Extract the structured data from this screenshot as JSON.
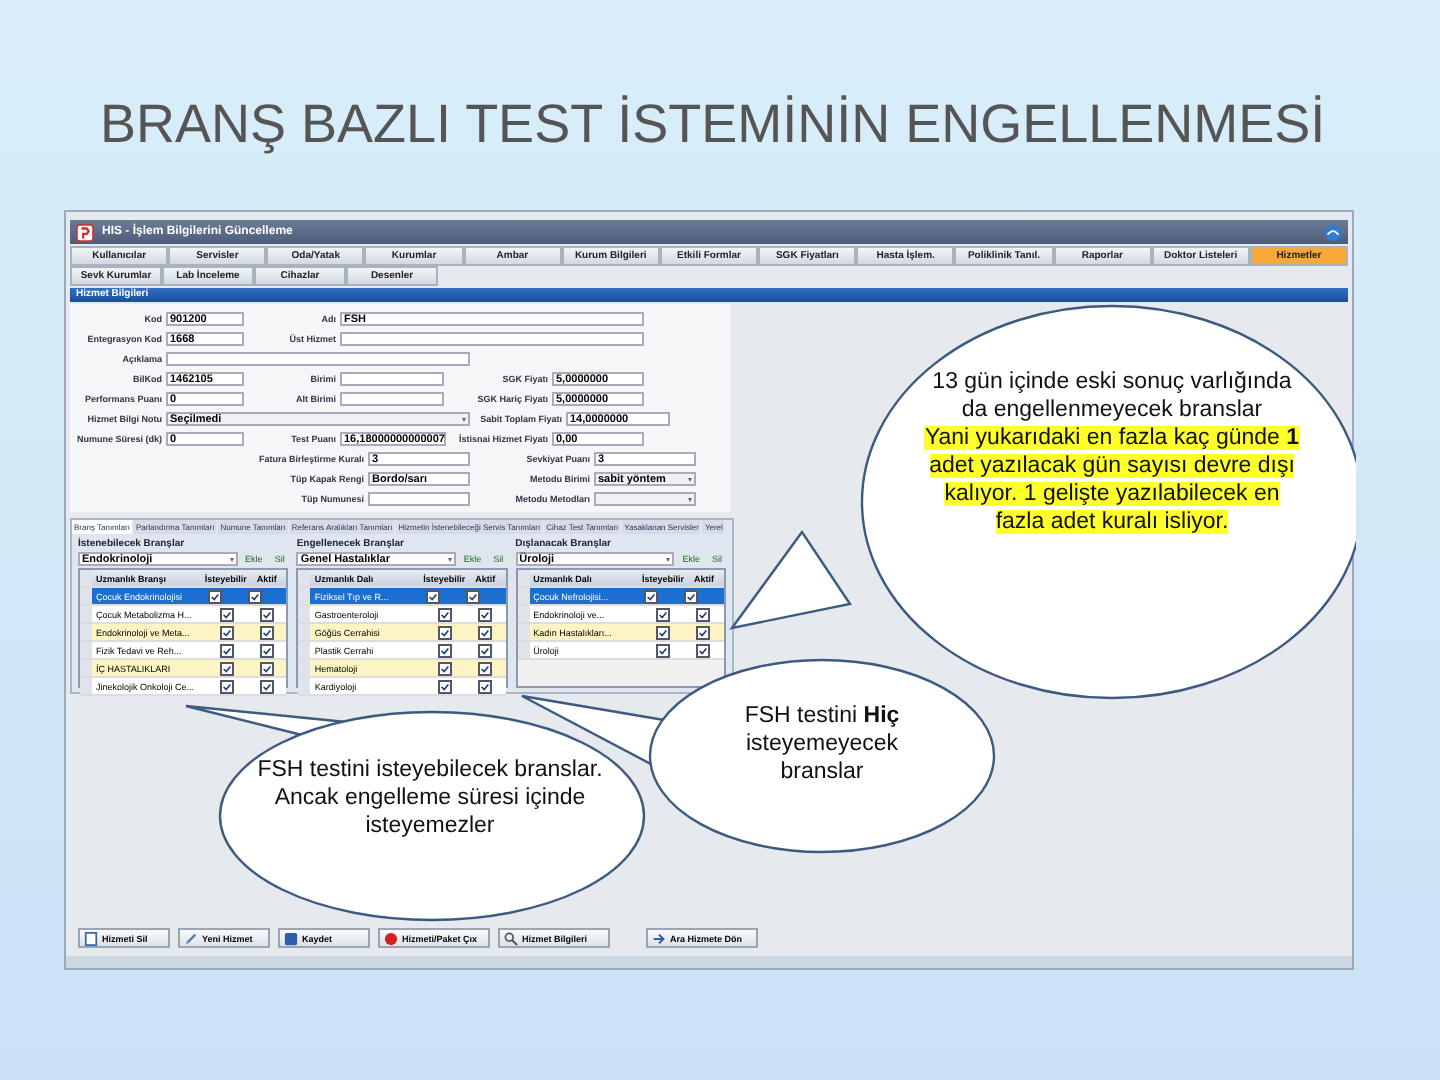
{
  "slide": {
    "title": "BRANŞ BAZLI TEST İSTEMİNİN ENGELLENMESİ"
  },
  "window": {
    "title": "HIS - İşlem Bilgilerini Güncelleme"
  },
  "menu_rows": [
    {
      "items": [
        {
          "label": "Kullanıcılar",
          "selected": false
        },
        {
          "label": "Servisler",
          "selected": false
        },
        {
          "label": "Oda/Yatak",
          "selected": false
        },
        {
          "label": "Kurumlar",
          "selected": false
        },
        {
          "label": "Ambar",
          "selected": false
        },
        {
          "label": "Kurum Bilgileri",
          "selected": false
        },
        {
          "label": "Etkili Formlar",
          "selected": false
        },
        {
          "label": "SGK Fiyatları",
          "selected": false
        },
        {
          "label": "Hasta İşlem.",
          "selected": false
        },
        {
          "label": "Poliklinik Tanıl.",
          "selected": false
        },
        {
          "label": "Raporlar",
          "selected": false
        },
        {
          "label": "Doktor Listeleri",
          "selected": false
        },
        {
          "label": "Hizmetler",
          "selected": true
        }
      ]
    },
    {
      "items": [
        {
          "label": "Sevk Kurumlar",
          "selected": false
        },
        {
          "label": "Lab İnceleme",
          "selected": false
        },
        {
          "label": "Cihazlar",
          "selected": false
        },
        {
          "label": "Desenler",
          "selected": false
        }
      ]
    }
  ],
  "section_header": "Hizmet Bilgileri",
  "form": {
    "main_rows": [
      {
        "fields": [
          {
            "label": "Kod",
            "value": "901200",
            "kind": "text"
          },
          {
            "label": "Adı",
            "value": "FSH",
            "kind": "wide"
          }
        ]
      },
      {
        "fields": [
          {
            "label": "Entegrasyon Kod",
            "value": "1668",
            "kind": "text"
          },
          {
            "label": "Üst Hizmet",
            "kind": "wide"
          }
        ]
      },
      {
        "fields": [
          {
            "label": "Açıklama",
            "kind": "wide"
          }
        ]
      },
      {
        "fields": [
          {
            "label": "BilKod",
            "value": "1462105",
            "kind": "text"
          },
          {
            "label": "Birimi",
            "kind": "text"
          },
          {
            "label": "SGK Fiyatı",
            "value": "5,0000000",
            "kind": "text"
          }
        ]
      },
      {
        "fields": [
          {
            "label": "Performans Puanı",
            "value": "0",
            "kind": "text"
          },
          {
            "label": "Alt Birimi",
            "kind": "text"
          },
          {
            "label": "SGK Hariç Fiyatı",
            "value": "5,0000000",
            "kind": "text"
          }
        ]
      },
      {
        "fields": [
          {
            "label": "Hizmet Bilgi Notu",
            "value": "Seçilmedi",
            "kind": "select"
          },
          {
            "label": "Sabit Toplam Fiyatı",
            "value": "14,0000000",
            "kind": "text"
          }
        ]
      },
      {
        "fields": [
          {
            "label": "Numune Süresi (dk)",
            "value": "0",
            "kind": "text"
          },
          {
            "label": "Test Puanı",
            "value": "16,18000000000007",
            "kind": "text"
          },
          {
            "label": "İstisnai Hizmet Fiyatı",
            "value": "0,00",
            "kind": "text"
          }
        ]
      }
    ],
    "lower_rows": [
      {
        "fields": [
          {
            "label": "Fatura Birleştirme Kuralı",
            "value": "3",
            "kind": "text"
          },
          {
            "label": "Sevkiyat Puanı",
            "value": "3",
            "kind": "text"
          }
        ]
      },
      {
        "fields": [
          {
            "label": "Tüp Kapak Rengi",
            "value": "Bordo/sarı",
            "kind": "text"
          },
          {
            "label": "Metodu Birimi",
            "value": "sabit yöntem",
            "kind": "select"
          }
        ]
      },
      {
        "fields": [
          {
            "label": "Tüp Numunesi",
            "kind": "text"
          },
          {
            "label": "Metodu Metodları",
            "kind": "select"
          }
        ]
      }
    ]
  },
  "detail_tabs": [
    {
      "label": "Branş Tanımları",
      "selected": true
    },
    {
      "label": "Parlandırma Tanımları",
      "selected": false
    },
    {
      "label": "Numune Tanımları",
      "selected": false
    },
    {
      "label": "Referans Aralıkları Tanımları",
      "selected": false
    },
    {
      "label": "Hizmetin İstenebileceği Servis Tanımları",
      "selected": false
    },
    {
      "label": "Cihaz Test Tanımları",
      "selected": false
    },
    {
      "label": "Yasaklanan Servisler",
      "selected": false
    },
    {
      "label": "Yerel",
      "selected": false
    }
  ],
  "panels": [
    {
      "title": "İstenebilecek Branşlar",
      "selector": "Endokrinoloji",
      "buttons": [
        "Ekle",
        "Sil"
      ],
      "columns": [
        "Uzmanlık Branşı",
        "İsteyebilir",
        "Aktif"
      ],
      "rows": [
        {
          "name": "Çocuk Endokrinolojisi",
          "request": true,
          "active": true,
          "selected": true
        },
        {
          "name": "Çocuk Metabolizma H...",
          "request": true,
          "active": true,
          "selected": false
        },
        {
          "name": "Endokrinoloji ve Meta...",
          "request": true,
          "active": true,
          "selected": false
        },
        {
          "name": "Fizik Tedavi ve Reh...",
          "request": true,
          "active": true,
          "selected": false
        },
        {
          "name": "İÇ HASTALIKLARI",
          "request": true,
          "active": true,
          "selected": false
        },
        {
          "name": "Jinekolojik Onkoloji Ce...",
          "request": true,
          "active": true,
          "selected": false
        }
      ]
    },
    {
      "title": "Engellenecek Branşlar",
      "selector": "Genel Hastalıklar",
      "buttons": [
        "Ekle",
        "Sil"
      ],
      "columns": [
        "Uzmanlık Dalı",
        "İsteyebilir",
        "Aktif"
      ],
      "rows": [
        {
          "name": "Fiziksel Tıp ve R...",
          "request": true,
          "active": true,
          "selected": true
        },
        {
          "name": "Gastroenteroloji",
          "request": true,
          "active": true,
          "selected": false
        },
        {
          "name": "Göğüs Cerrahisi",
          "request": true,
          "active": true,
          "selected": false
        },
        {
          "name": "Plastik Cerrahi",
          "request": true,
          "active": true,
          "selected": false
        },
        {
          "name": "Hematoloji",
          "request": true,
          "active": true,
          "selected": false
        },
        {
          "name": "Kardiyoloji",
          "request": true,
          "active": true,
          "selected": false
        }
      ]
    },
    {
      "title": "Dışlanacak Branşlar",
      "selector": "Üroloji",
      "buttons": [
        "Ekle",
        "Sil"
      ],
      "columns": [
        "Uzmanlık Dalı",
        "İsteyebilir",
        "Aktif"
      ],
      "rows": [
        {
          "name": "Çocuk Nefrolojisi...",
          "request": true,
          "active": true,
          "selected": true
        },
        {
          "name": "Endokrinoloji ve...",
          "request": true,
          "active": true,
          "selected": false
        },
        {
          "name": "Kadın Hastalıkları...",
          "request": true,
          "active": true,
          "selected": false
        },
        {
          "name": "Üroloji",
          "request": true,
          "active": true,
          "selected": false
        }
      ]
    }
  ],
  "footer_buttons": [
    {
      "label": "Hizmeti Sil"
    },
    {
      "label": "Yeni Hizmet"
    },
    {
      "label": "Kaydet"
    },
    {
      "label": "Hizmeti/Paket Çıx"
    },
    {
      "label": "Hizmet Bilgileri"
    },
    {
      "label": "Ara Hizmete Dön"
    }
  ],
  "callouts": [
    {
      "paragraphs": [
        {
          "text": "13 gün içinde eski sonuç varlığında da engellenmeyecek branslar",
          "highlighted": false
        },
        {
          "text": "Yani yukarıdaki en fazla kaç günde **1** adet yazılacak gün sayısı devre dışı kalıyor. 1 gelişte yazılabilecek en fazla adet kuralı isliyor.",
          "highlighted": true
        }
      ]
    },
    {
      "paragraphs": [
        {
          "text": "FSH testini **Hiç** isteyemeyecek branslar",
          "highlighted": false
        }
      ]
    },
    {
      "paragraphs": [
        {
          "text": "FSH testini isteyebilecek branslar. Ancak engelleme süresi içinde isteyemezler",
          "highlighted": false
        }
      ]
    }
  ]
}
